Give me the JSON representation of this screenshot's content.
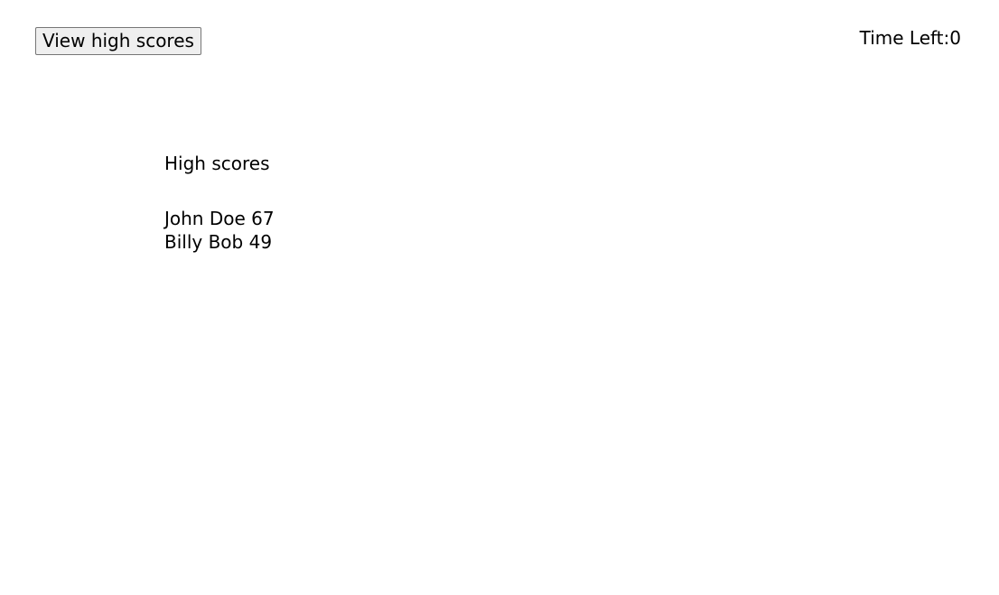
{
  "header": {
    "view_scores_label": "View high scores",
    "timer_label": "Time Left:",
    "timer_value": "0"
  },
  "scores": {
    "title": "High scores",
    "entries": [
      {
        "name": "John Doe",
        "score": "67"
      },
      {
        "name": "Billy Bob",
        "score": "49"
      }
    ]
  }
}
